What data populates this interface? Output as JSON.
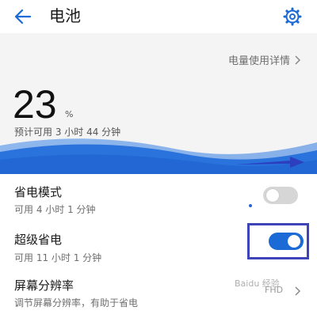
{
  "header": {
    "title": "电池",
    "back_icon": "arrow-left-icon",
    "settings_icon": "gear-icon",
    "accent_color": "#1b6ad6"
  },
  "battery": {
    "details_link": "电量使用详情",
    "percent": "23",
    "percent_unit": "%",
    "remaining": "预计可用 3 小时 44 分钟"
  },
  "rows": [
    {
      "title": "省电模式",
      "subtitle": "可用 4 小时 1 分钟",
      "toggle_on": false
    },
    {
      "title": "超级省电",
      "subtitle": "可用 11 小时 1 分钟",
      "toggle_on": true
    },
    {
      "title": "屏幕分辨率",
      "subtitle": "调节屏幕分辨率，有助于省电",
      "value": "FHD"
    }
  ],
  "watermark": "Baidu 经验"
}
